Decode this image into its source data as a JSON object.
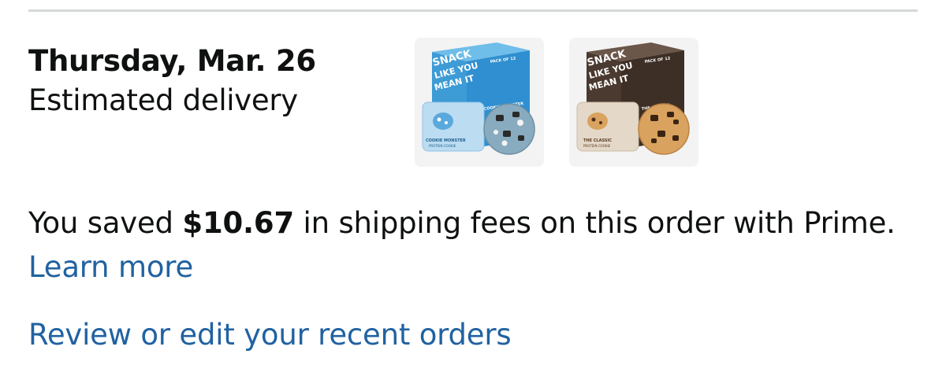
{
  "delivery": {
    "date": "Thursday, Mar. 26",
    "label": "Estimated delivery"
  },
  "products": [
    {
      "name": "Cookie Monster protein cookie box",
      "box_color": "#3d9bd6",
      "box_text_lines": [
        "SNACK",
        "LIKE YOU",
        "MEAN IT"
      ],
      "pack_label": "PACK OF 12",
      "flavor_label": "COOKIE MONSTER",
      "wrapper_text": "COOKIE MONSTER",
      "wrapper_subtext": "PROTEIN COOKIE"
    },
    {
      "name": "The Classic protein cookie box",
      "box_color": "#4a3a30",
      "box_text_lines": [
        "SNACK",
        "LIKE YOU",
        "MEAN IT"
      ],
      "pack_label": "PACK OF 12",
      "flavor_label": "THE CLASSIC",
      "wrapper_text": "THE CLASSIC",
      "wrapper_subtext": "PROTEIN COOKIE"
    }
  ],
  "savings": {
    "prefix": "You saved ",
    "amount": "$10.67",
    "suffix": " in shipping fees on this order with Prime. ",
    "learn_more": "Learn more"
  },
  "review_link": "Review or edit your recent orders",
  "colors": {
    "link": "#2162a1",
    "divider": "#d5d9d9",
    "text": "#0f1111"
  }
}
